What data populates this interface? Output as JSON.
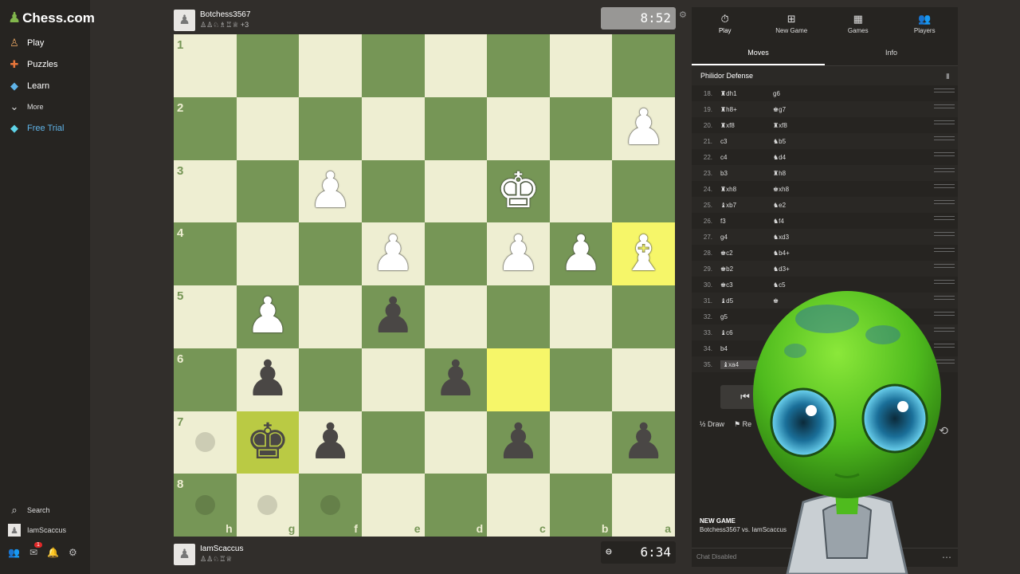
{
  "brand": {
    "name": "Chess.com"
  },
  "nav": {
    "items": [
      {
        "label": "Play",
        "icon": "play-icon"
      },
      {
        "label": "Puzzles",
        "icon": "puzzle-icon"
      },
      {
        "label": "Learn",
        "icon": "learn-icon"
      },
      {
        "label": "More",
        "icon": "chevron-down-icon"
      },
      {
        "label": "Free Trial",
        "icon": "diamond-icon"
      }
    ],
    "search": "Search",
    "user": "IamScaccus"
  },
  "top_player": {
    "name": "Botchess3567",
    "captures": "♙♙♘♗♖♕ +3",
    "clock": "8:52"
  },
  "bottom_player": {
    "name": "IamScaccus",
    "captures": "♙♙♘♖♕",
    "clock": "6:34"
  },
  "board": {
    "ranks": [
      "1",
      "2",
      "3",
      "4",
      "5",
      "6",
      "7",
      "8"
    ],
    "files": [
      "h",
      "g",
      "f",
      "e",
      "d",
      "c",
      "b",
      "a"
    ]
  },
  "panel": {
    "tabs": [
      {
        "label": "Play",
        "icon": "stopwatch-icon"
      },
      {
        "label": "New Game",
        "icon": "plus-icon"
      },
      {
        "label": "Games",
        "icon": "board-icon"
      },
      {
        "label": "Players",
        "icon": "players-icon"
      }
    ],
    "subtabs": [
      "Moves",
      "Info"
    ],
    "opening": "Philidor Defense",
    "moves": [
      {
        "no": "18.",
        "w": "♜dh1",
        "b": "g6"
      },
      {
        "no": "19.",
        "w": "♜h8+",
        "b": "♚g7"
      },
      {
        "no": "20.",
        "w": "♜xf8",
        "b": "♜xf8"
      },
      {
        "no": "21.",
        "w": "c3",
        "b": "♞b5"
      },
      {
        "no": "22.",
        "w": "c4",
        "b": "♞d4"
      },
      {
        "no": "23.",
        "w": "b3",
        "b": "♜h8"
      },
      {
        "no": "24.",
        "w": "♜xh8",
        "b": "♚xh8"
      },
      {
        "no": "25.",
        "w": "♝xb7",
        "b": "♞e2"
      },
      {
        "no": "26.",
        "w": "f3",
        "b": "♞f4"
      },
      {
        "no": "27.",
        "w": "g4",
        "b": "♞xd3"
      },
      {
        "no": "28.",
        "w": "♚c2",
        "b": "♞b4+"
      },
      {
        "no": "29.",
        "w": "♚b2",
        "b": "♞d3+"
      },
      {
        "no": "30.",
        "w": "♚c3",
        "b": "♞c5"
      },
      {
        "no": "31.",
        "w": "♝d5",
        "b": "♚"
      },
      {
        "no": "32.",
        "w": "g5",
        "b": ""
      },
      {
        "no": "33.",
        "w": "♝c6",
        "b": ""
      },
      {
        "no": "34.",
        "w": "b4",
        "b": ""
      },
      {
        "no": "35.",
        "w": "♝xa4",
        "b": ""
      }
    ],
    "draw": "Draw",
    "resign": "Re",
    "new_game_title": "NEW GAME",
    "new_game_sub": "Botchess3567 vs. IamScaccus",
    "chat": "Chat Disabled"
  },
  "colors": {
    "light": "#eeeed2",
    "dark": "#769656",
    "highlight": "#f6f669",
    "accent": "#81b64c"
  }
}
